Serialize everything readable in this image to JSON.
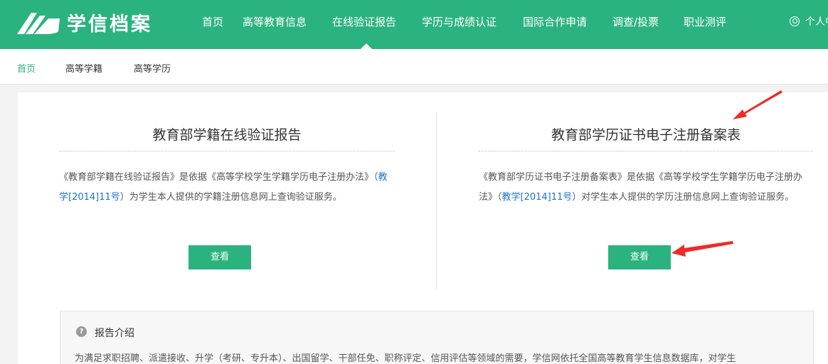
{
  "header": {
    "logo_text": "学信档案",
    "nav": [
      {
        "label": "首页"
      },
      {
        "label": "高等教育信息"
      },
      {
        "label": "在线验证报告"
      },
      {
        "label": "学历与成绩认证"
      },
      {
        "label": "国际合作申请"
      },
      {
        "label": "调查/投票"
      },
      {
        "label": "职业测评"
      }
    ],
    "active_nav": "在线验证报告",
    "user_label": "个人中心"
  },
  "subnav": {
    "items": [
      {
        "label": "首页",
        "active": true
      },
      {
        "label": "高等学籍"
      },
      {
        "label": "高等学历"
      }
    ]
  },
  "panels": [
    {
      "title": "教育部学籍在线验证报告",
      "desc_prefix": "《教育部学籍在线验证报告》是依据《高等学校学生学籍学历电子注册办法》（",
      "desc_link": "教学[2014]11号",
      "desc_suffix": "）为学生本人提供的学籍注册信息网上查询验证服务。",
      "button": "查看"
    },
    {
      "title": "教育部学历证书电子注册备案表",
      "desc_prefix": "《教育部学历证书电子注册备案表》是依据《高等学校学生学籍学历电子注册办法》（",
      "desc_link": "教学[2014]11号",
      "desc_suffix": "）对学生本人提供的学历注册信息网上查询验证服务。",
      "button": "查看"
    }
  ],
  "intro": {
    "title": "报告介绍",
    "text": "为满足求职招聘、派遣接收、升学（考研、专升本）、出国留学、干部任免、职称评定、信用评估等领域的需要，学信网依托全国高等教育学生信息数据库，对学生"
  },
  "colors": {
    "brand": "#2bb37f",
    "link": "#1f74c9",
    "annotation_arrow": "#ee2b2b"
  }
}
